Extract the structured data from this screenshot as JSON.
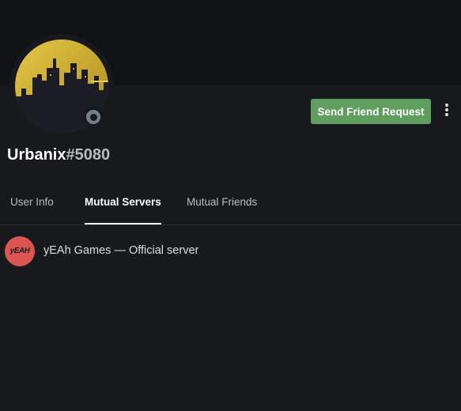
{
  "user": {
    "name": "Urbanix",
    "discriminator": "#5080",
    "avatar_icon": "city-skyline-avatar-icon",
    "status": "offline",
    "status_color": "#747f8d"
  },
  "actions": {
    "send_friend_request_label": "Send Friend Request",
    "button_color": "#5f9e5f",
    "more_icon": "vertical-ellipsis-icon"
  },
  "tabs": [
    {
      "label": "User Info",
      "active": false
    },
    {
      "label": "Mutual Servers",
      "active": true
    },
    {
      "label": "Mutual Friends",
      "active": false
    }
  ],
  "mutual_servers": [
    {
      "name": "yEAh Games — Official server",
      "icon_text": "yEAH",
      "icon_color": "#dd5552"
    }
  ],
  "colors": {
    "background": "#18191c",
    "banner": "#111214",
    "text_primary": "#ffffff",
    "text_muted": "#b9bbbe"
  }
}
